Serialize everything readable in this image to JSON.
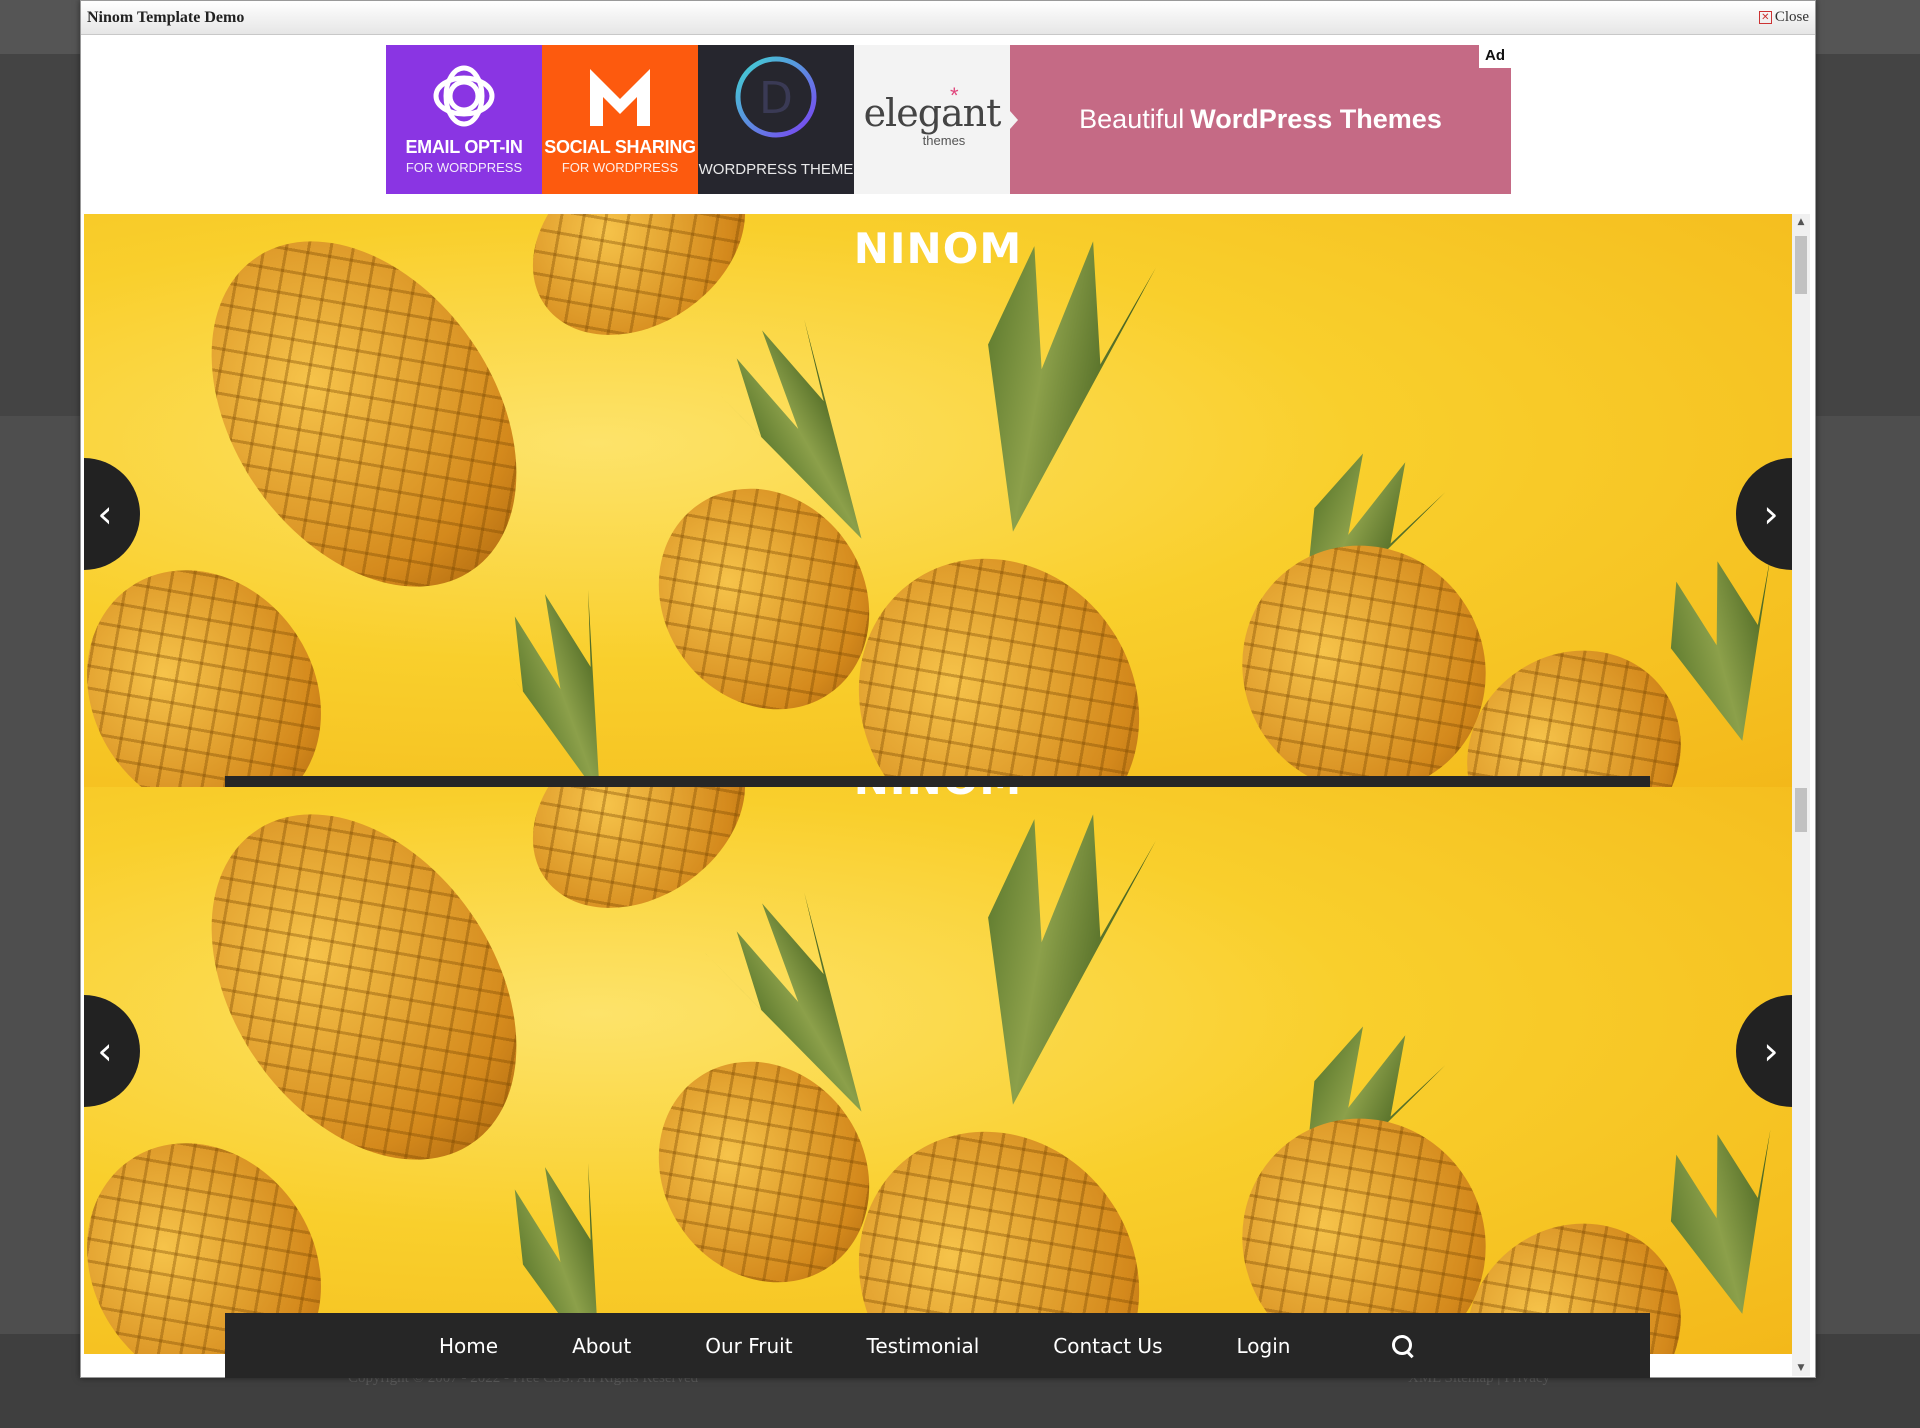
{
  "modal": {
    "title": "Ninom Template Demo",
    "close_label": "Close"
  },
  "ad": {
    "badge": "Ad",
    "tiles": [
      {
        "line1": "EMAIL OPT-IN",
        "line2": "FOR WORDPRESS",
        "color": "#8a35e3",
        "icon": "bloom-logo-icon"
      },
      {
        "line1": "SOCIAL SHARING",
        "line2": "FOR WORDPRESS",
        "color": "#fd5a0e",
        "icon": "monarch-logo-icon"
      },
      {
        "line1": "",
        "line2": "WORDPRESS THEME",
        "color": "#26262e",
        "icon": "divi-logo-icon"
      },
      {
        "line1": "elegant",
        "line2": "themes",
        "color": "#f3f3f3",
        "icon": "elegant-themes-logo"
      }
    ],
    "headline_light": "Beautiful",
    "headline_bold": "WordPress Themes",
    "bg_color": "#c56a85"
  },
  "hero": {
    "title": "NINOM",
    "prev_icon": "chevron-left-icon",
    "next_icon": "chevron-right-icon",
    "prev_glyph": "‹",
    "next_glyph": "›"
  },
  "nav": {
    "items": [
      "Home",
      "About",
      "Our Fruit",
      "Testimonial",
      "Contact Us",
      "Login"
    ],
    "search_icon": "search-icon"
  },
  "footer": {
    "copyright": "Copyright © 2007 - 2022 - Free CSS. All Rights Reserved",
    "links": "XML Sitemap | Privacy"
  }
}
